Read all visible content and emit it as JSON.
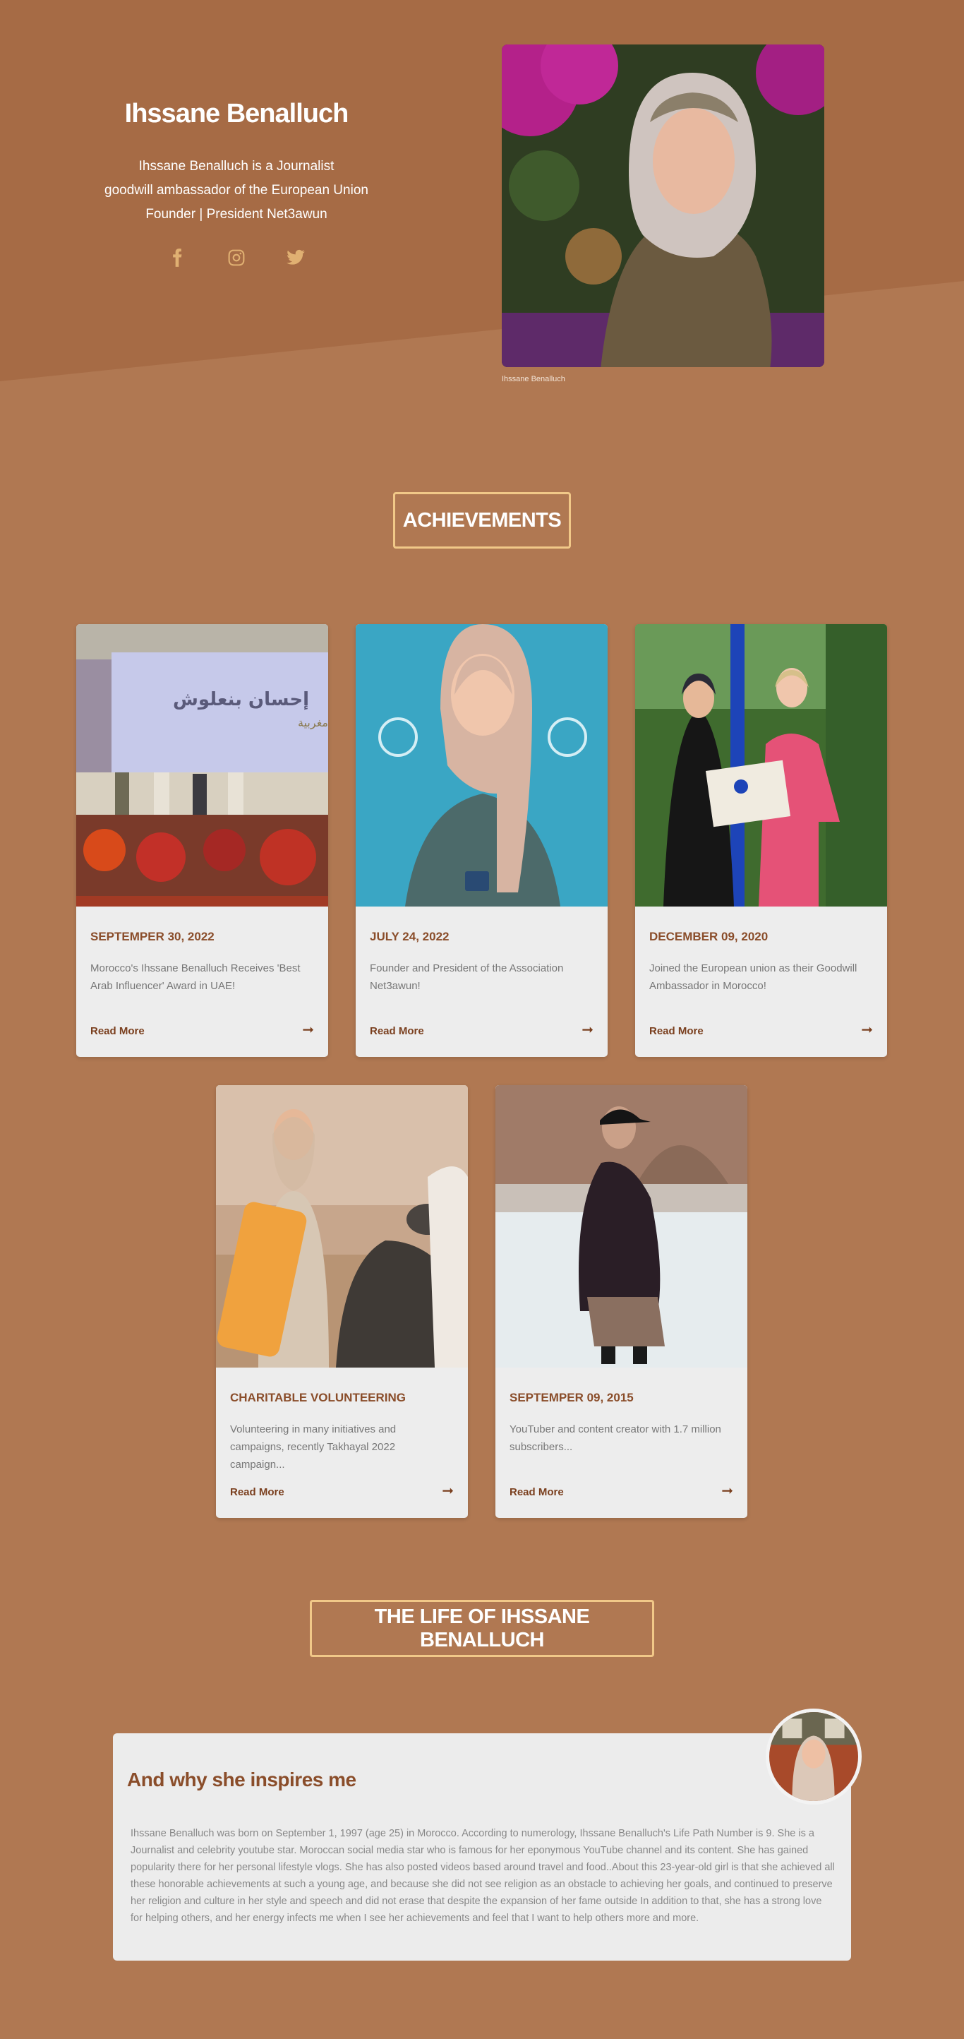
{
  "hero": {
    "name": "Ihssane Benalluch",
    "lines": [
      "Ihssane Benalluch is a Journalist",
      "goodwill ambassador of the European Union",
      "Founder | President Net3awun"
    ],
    "social": [
      "facebook-icon",
      "instagram-icon",
      "twitter-icon"
    ],
    "portrait_caption": "Ihssane Benalluch"
  },
  "achievements": {
    "heading": "ACHIEVEMENTS",
    "cards": [
      {
        "date": "SEPTEMPER 30, 2022",
        "desc": "Morocco's Ihssane Benalluch Receives 'Best Arab Influencer' Award in UAE!",
        "link": "Read More"
      },
      {
        "date": "JULY 24, 2022",
        "desc": "Founder and President of the Association Net3awun!",
        "link": "Read More"
      },
      {
        "date": "DECEMBER 09, 2020",
        "desc": "Joined the European union as their Goodwill Ambassador in Morocco!",
        "link": "Read More"
      },
      {
        "date": "CHARITABLE VOLUNTEERING",
        "desc": "Volunteering in many initiatives and campaigns, recently Takhayal 2022 campaign...",
        "link": "Read More"
      },
      {
        "date": "SEPTEMPER 09, 2015",
        "desc": "YouTuber and content creator with 1.7 million subscribers...",
        "link": "Read More"
      }
    ]
  },
  "life": {
    "heading": "THE LIFE OF IHSSANE BENALLUCH",
    "title": "And why she inspires me",
    "text": "Ihssane Benalluch was born on September 1, 1997 (age 25) in Morocco. According to numerology, Ihssane Benalluch's Life Path Number is 9. She is a Journalist and celebrity youtube star. Moroccan social media star who is famous for her eponymous YouTube channel and its content. She has gained popularity there for her personal lifestyle vlogs. She has also posted videos based around travel and food..About this 23-year-old girl is that she achieved all these honorable achievements at such a young age, and because she did not see religion as an obstacle to achieving her goals, and continued to preserve her religion and culture in her style and speech and did not erase that despite the expansion of her fame outside In addition to that, she has a strong love for helping others, and her energy infects me when I see her achievements and feel that I want to help others more and more."
  },
  "colors": {
    "background": "#b07852",
    "hero_dark": "#a66b45",
    "accent_border": "#f1c888",
    "card_title": "#8a4d2a"
  },
  "photo_text": {
    "award_banner": "إحسان بنعلوش",
    "award_sub": "مغربية"
  }
}
